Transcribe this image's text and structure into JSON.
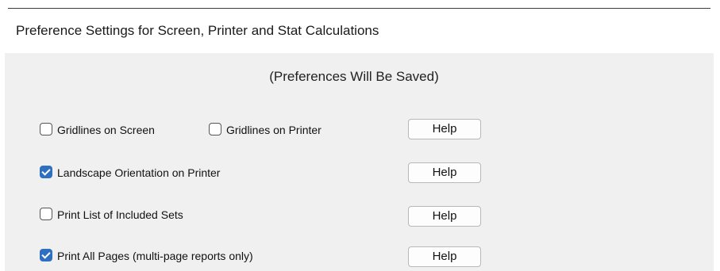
{
  "dialog": {
    "title": "Preference Settings for Screen, Printer and Stat Calculations",
    "subtitle": "(Preferences Will Be Saved)"
  },
  "options": [
    {
      "label": "Gridlines on Screen",
      "checked": false
    },
    {
      "label": "Gridlines on Printer",
      "checked": false
    },
    {
      "label": "Landscape Orientation on Printer",
      "checked": true
    },
    {
      "label": "Print List of Included Sets",
      "checked": false
    },
    {
      "label": "Print All Pages (multi-page reports only)",
      "checked": true
    }
  ],
  "help_buttons": [
    {
      "label": "Help"
    },
    {
      "label": "Help"
    },
    {
      "label": "Help"
    },
    {
      "label": "Help"
    }
  ],
  "colors": {
    "checked_accent": "#2f6fc1",
    "dialog_background": "#f0f0f0",
    "titlebar_background": "#ffffff"
  }
}
